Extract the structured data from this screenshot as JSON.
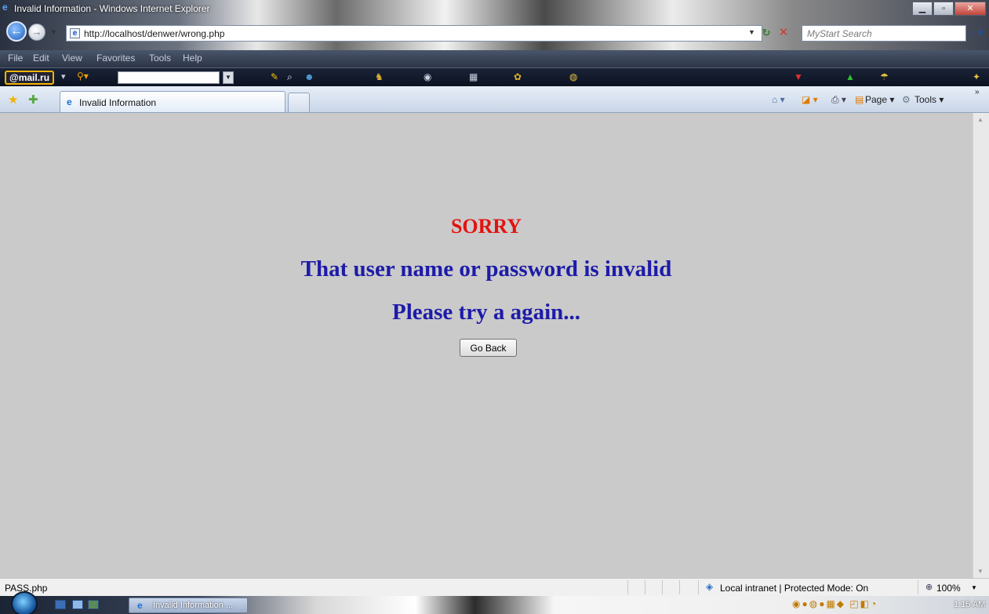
{
  "window": {
    "title": "Invalid Information - Windows Internet Explorer"
  },
  "address": {
    "url": "http://localhost/denwer/wrong.php"
  },
  "search": {
    "placeholder": "MyStart Search"
  },
  "menu": {
    "items": [
      "File",
      "Edit",
      "View",
      "Favorites",
      "Tools",
      "Help"
    ]
  },
  "mailru": {
    "logo": "@mail.ru"
  },
  "tab": {
    "label": "Invalid Information"
  },
  "commands": {
    "page": "Page ▾",
    "tools": "Tools ▾"
  },
  "content": {
    "sorry": "SORRY",
    "invalid": "That user name or password is invalid",
    "again": "Please try a again...",
    "button": "Go Back"
  },
  "status": {
    "text": "PASS.php",
    "zone": "Local intranet | Protected Mode: On",
    "zoom": "100%"
  },
  "taskbar": {
    "task_label": "Invalid Information ...",
    "clock": "1:15 AM"
  },
  "colors": {
    "sorry": "#e4120f",
    "message": "#1d1ba8",
    "page_background": "#cacaca"
  }
}
